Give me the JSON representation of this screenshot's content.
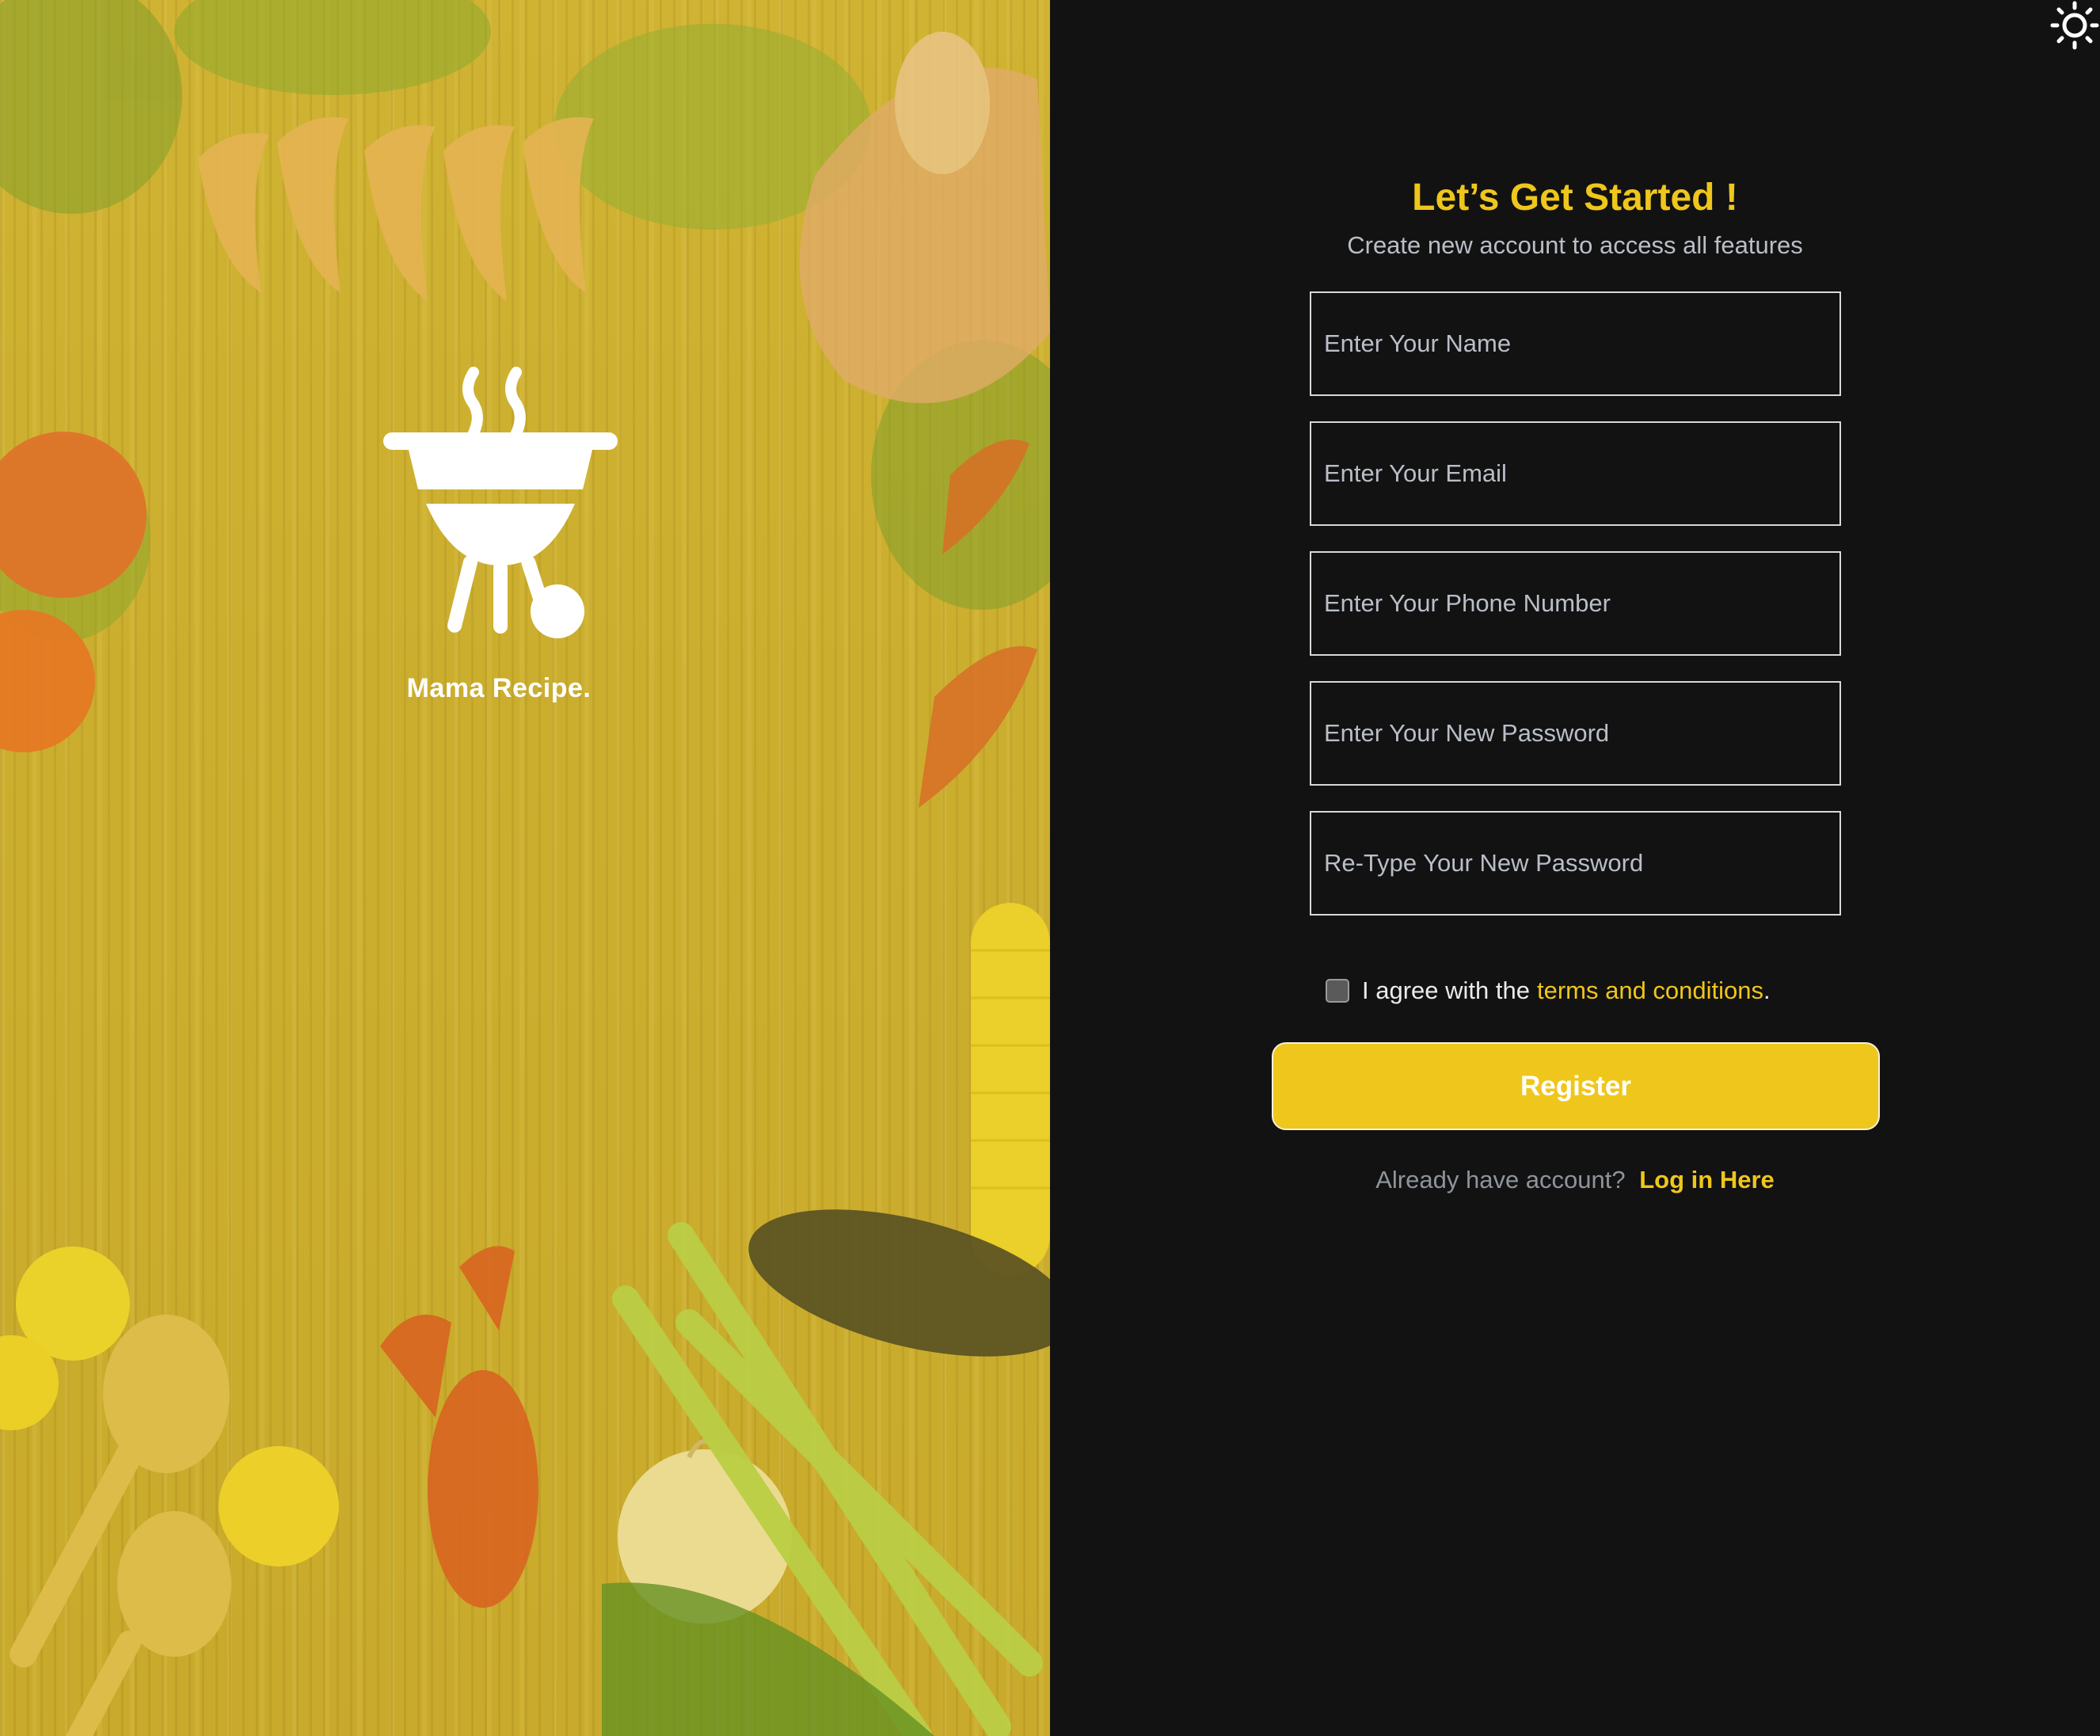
{
  "brand": {
    "name": "Mama Recipe.",
    "logo_icon": "grill-icon",
    "hero_image": "vegetables-seafood-on-wooden-table"
  },
  "header": {
    "theme_toggle_icon": "sun-icon"
  },
  "form": {
    "title": "Let’s Get Started !",
    "subtitle": "Create new account to access all features",
    "fields": [
      {
        "placeholder": "Enter Your Name",
        "value": ""
      },
      {
        "placeholder": "Enter Your Email",
        "value": ""
      },
      {
        "placeholder": "Enter Your Phone Number",
        "value": ""
      },
      {
        "placeholder": "Enter Your New Password",
        "value": ""
      },
      {
        "placeholder": "Re-Type Your New Password",
        "value": ""
      }
    ],
    "agree": {
      "text": "I agree with the",
      "link": "terms and conditions",
      "suffix": ".",
      "checked": false
    },
    "register_label": "Register",
    "login_prompt": "Already have account?",
    "login_link": "Log in Here"
  },
  "colors": {
    "accent": "#efc61b",
    "background": "#121212",
    "hero_overlay": "#d4b52a"
  }
}
